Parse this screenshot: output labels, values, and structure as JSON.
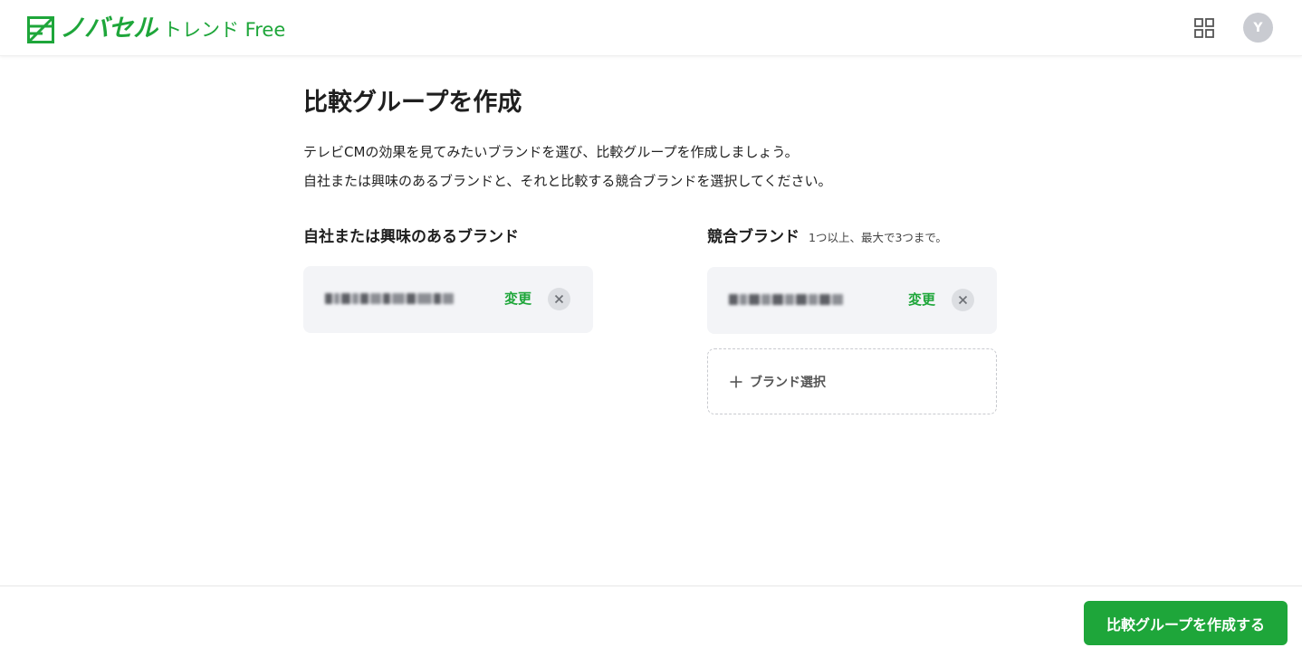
{
  "header": {
    "logo_brand": "ノバセル",
    "logo_sub": "トレンド Free",
    "avatar_initial": "Y"
  },
  "page": {
    "title": "比較グループを作成",
    "description_lines": [
      "テレビCMの効果を見てみたいブランドを選び、比較グループを作成しましょう。",
      "自社または興味のあるブランドと、それと比較する競合ブランドを選択してください。"
    ]
  },
  "own_brand": {
    "heading": "自社または興味のあるブランド",
    "change_label": "変更"
  },
  "competitor": {
    "heading": "競合ブランド",
    "note": "1つ以上、最大で3つまで。",
    "change_label": "変更",
    "add_label": "ブランド選択"
  },
  "footer": {
    "submit_label": "比較グループを作成する"
  },
  "colors": {
    "brand_green": "#1ea63a",
    "card_bg": "#f3f4f7"
  }
}
